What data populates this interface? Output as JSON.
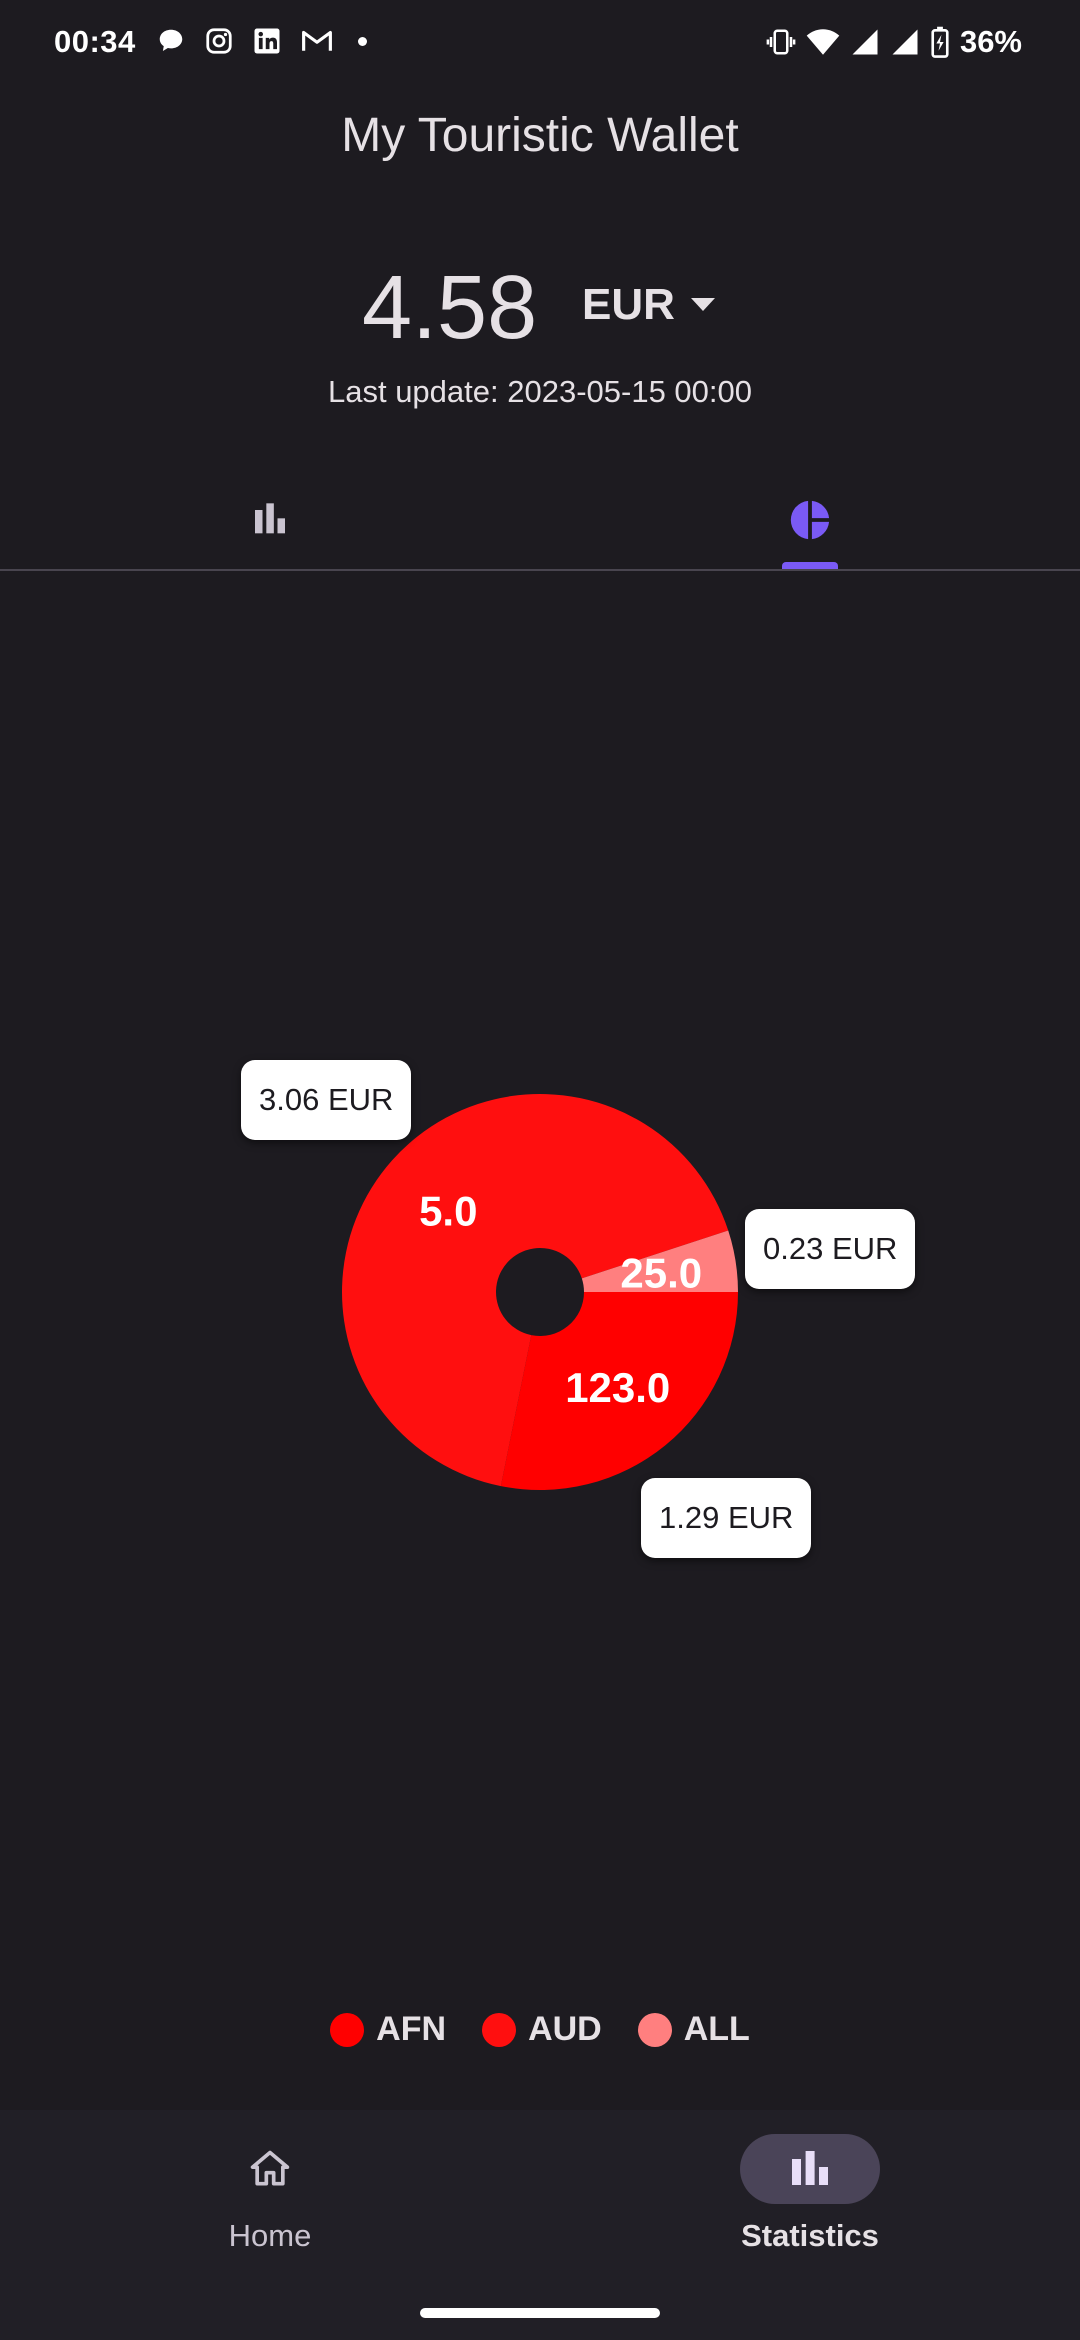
{
  "status_bar": {
    "time": "00:34",
    "battery": "36%",
    "left_icons": [
      "chat-bubble-icon",
      "instagram-icon",
      "linkedin-icon",
      "gmail-icon"
    ],
    "right_icons": [
      "vibrate-icon",
      "wifi-icon",
      "signal-icon",
      "signal-icon",
      "battery-charging-icon"
    ]
  },
  "header": {
    "title": "My Touristic Wallet",
    "balance": "4.58",
    "currency": "EUR",
    "last_update": "Last update: 2023-05-15 00:00"
  },
  "tabs": [
    {
      "icon": "bar-chart-icon",
      "selected": false
    },
    {
      "icon": "pie-chart-icon",
      "selected": true
    }
  ],
  "chart_data": {
    "type": "pie",
    "donut": true,
    "slices": [
      {
        "currency": "AFN",
        "amount": "123.0",
        "eur_label": "1.29 EUR",
        "eur_value": 1.29,
        "color": "#ff0000"
      },
      {
        "currency": "AUD",
        "amount": "5.0",
        "eur_label": "3.06 EUR",
        "eur_value": 3.06,
        "color": "#ff0f0f"
      },
      {
        "currency": "ALL",
        "amount": "25.0",
        "eur_label": "0.23 EUR",
        "eur_value": 0.23,
        "color": "#ff7f7f"
      }
    ],
    "legend": [
      {
        "label": "AFN",
        "color": "#ff0000"
      },
      {
        "label": "AUD",
        "color": "#ff0f0f"
      },
      {
        "label": "ALL",
        "color": "#ff7f7f"
      }
    ],
    "legend_position": "bottom"
  },
  "bottom_nav": {
    "items": [
      {
        "label": "Home",
        "icon": "home-icon",
        "selected": false
      },
      {
        "label": "Statistics",
        "icon": "bar-chart-icon",
        "selected": true
      }
    ]
  },
  "colors": {
    "background": "#1d1b20",
    "accent": "#7a5af5",
    "nav_background": "#211f26",
    "nav_pill": "#4a4458"
  }
}
